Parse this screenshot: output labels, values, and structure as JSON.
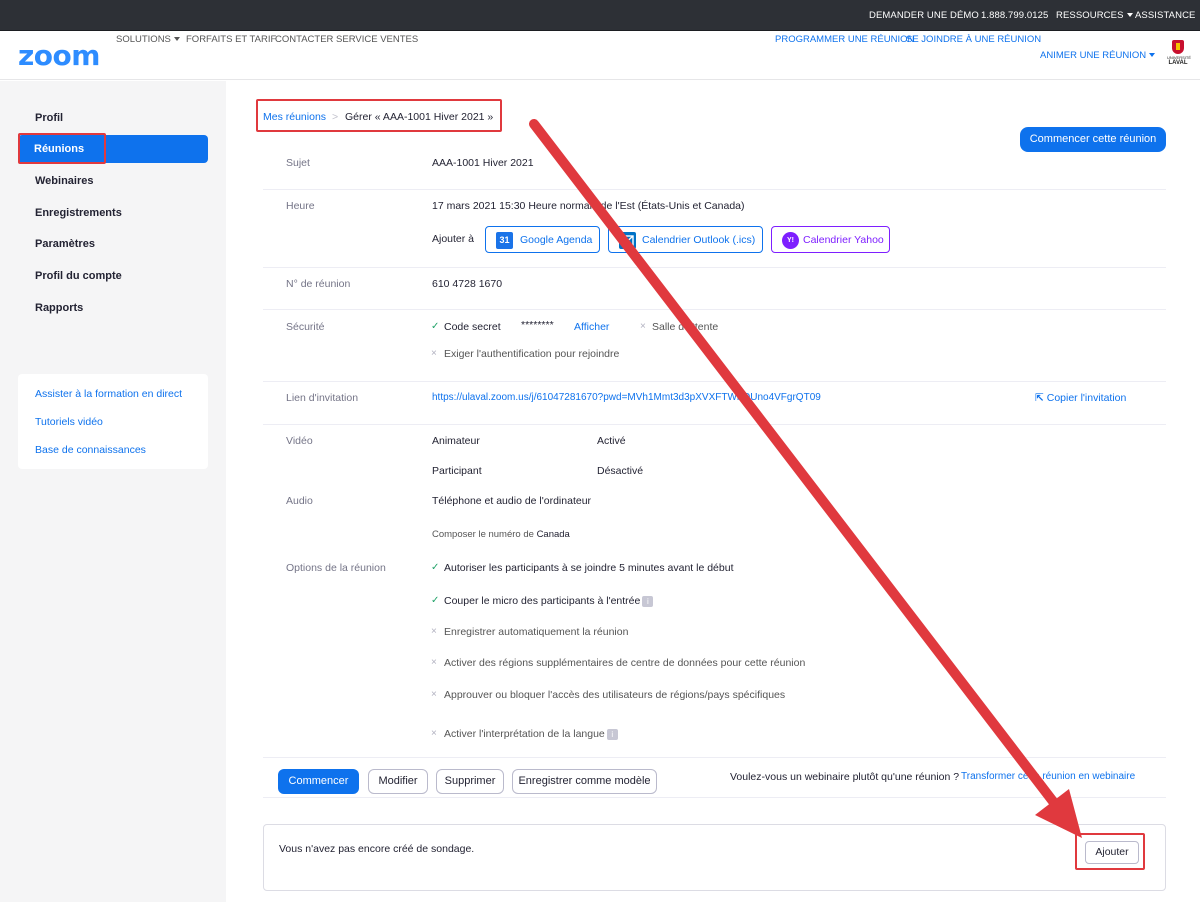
{
  "topbar": {
    "demo": "DEMANDER UNE DÉMO",
    "phone": "1.888.799.0125",
    "resources": "RESSOURCES",
    "support": "ASSISTANCE"
  },
  "header": {
    "logo": "zoom",
    "solutions": "SOLUTIONS",
    "plans": "FORFAITS ET TARIF",
    "contact": "CONTACTER SERVICE VENTES",
    "schedule": "PROGRAMMER UNE RÉUNION",
    "join": "SE JOINDRE À UNE RÉUNION",
    "host": "ANIMER UNE RÉUNION",
    "ulaval_line1": "UNIVERSITÉ",
    "ulaval_line2": "LAVAL"
  },
  "sidebar": {
    "items": [
      "Profil",
      "Réunions",
      "Webinaires",
      "Enregistrements",
      "Paramètres",
      "Profil du compte",
      "Rapports"
    ],
    "help": [
      "Assister à la formation en direct",
      "Tutoriels vidéo",
      "Base de connaissances"
    ]
  },
  "breadcrumb": {
    "root": "Mes réunions",
    "sep": ">",
    "current": "Gérer « AAA-1001 Hiver 2021 »"
  },
  "start_meeting_button": "Commencer cette réunion",
  "meeting": {
    "topic_label": "Sujet",
    "topic": "AAA-1001 Hiver 2021",
    "time_label": "Heure",
    "time": "17 mars 2021 15:30 Heure normale de l'Est (États-Unis et Canada)",
    "add_to": "Ajouter à",
    "google": "Google Agenda",
    "google_icon_text": "31",
    "outlook": "Calendrier Outlook (.ics)",
    "yahoo": "Calendrier Yahoo",
    "yahoo_icon_text": "Y!",
    "id_label": "N° de réunion",
    "id": "610 4728 1670",
    "security_label": "Sécurité",
    "passcode": "Code secret",
    "passcode_mask": "********",
    "show": "Afficher",
    "waiting_room": "Salle d'attente",
    "auth": "Exiger l'authentification pour rejoindre",
    "invite_label": "Lien d'invitation",
    "invite_url": "https://ulaval.zoom.us/j/61047281670?pwd=MVh1Mmt3d3pXVXFTWhOUno4VFgrQT09",
    "copy_invite": "Copier l'invitation",
    "video_label": "Vidéo",
    "host_video": "Animateur",
    "host_video_state": "Activé",
    "participant_video": "Participant",
    "participant_video_state": "Désactivé",
    "audio_label": "Audio",
    "audio": "Téléphone et audio de l'ordinateur",
    "dial_in_prefix": "Composer le numéro de",
    "dial_in_country": "Canada",
    "options_label": "Options de la réunion",
    "options": [
      {
        "text": "Autoriser les participants à se joindre 5 minutes avant le début",
        "on": true
      },
      {
        "text": "Couper le micro des participants à l'entrée",
        "on": true,
        "info": true
      },
      {
        "text": "Enregistrer automatiquement la réunion",
        "on": false
      },
      {
        "text": "Activer des régions supplémentaires de centre de données pour cette réunion",
        "on": false
      },
      {
        "text": "Approuver ou bloquer l'accès des utilisateurs de régions/pays spécifiques",
        "on": false
      },
      {
        "text": "Activer l'interprétation de la langue",
        "on": false,
        "info": true
      }
    ],
    "info_icon_text": "i"
  },
  "actions": {
    "start": "Commencer",
    "edit": "Modifier",
    "delete": "Supprimer",
    "save_template": "Enregistrer comme modèle",
    "webinar_question": "Voulez-vous un webinaire plutôt qu'une réunion ?",
    "convert": "Transformer cette réunion en webinaire"
  },
  "poll": {
    "empty": "Vous n'avez pas encore créé de sondage.",
    "add": "Ajouter"
  },
  "colors": {
    "accent": "#0e72ed",
    "topbar": "#2d3036",
    "annotation_red": "#e0393e",
    "check_green": "#23a36a",
    "yahoo_purple": "#7e1fff"
  }
}
